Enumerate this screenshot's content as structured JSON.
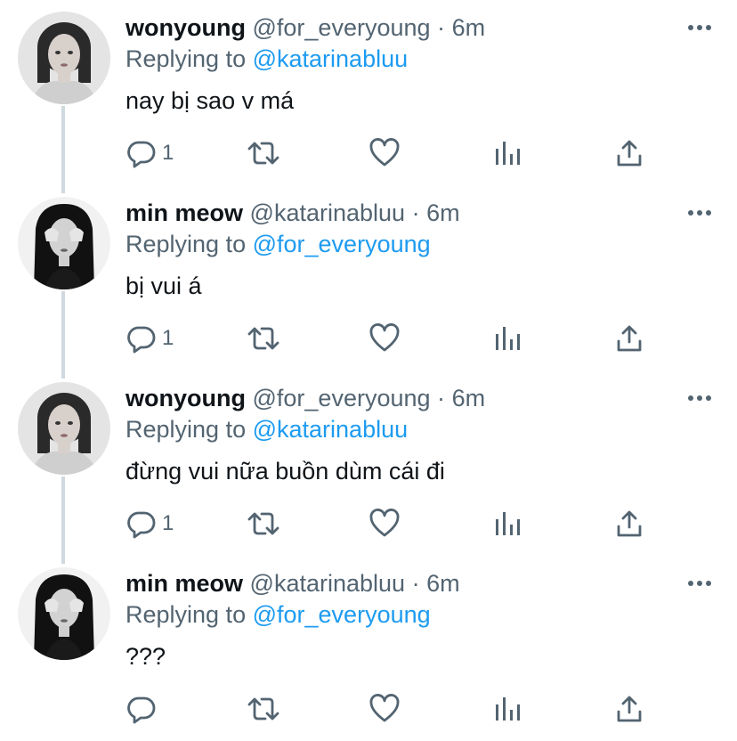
{
  "tweets": [
    {
      "name": "wonyoung",
      "handle": "@for_everyoung",
      "separator": "·",
      "time": "6m",
      "replying_label": "Replying to",
      "replying_to": "@katarinabluu",
      "text": "nay bị sao v má",
      "reply_count": "1",
      "avatar_style": "light"
    },
    {
      "name": "min meow",
      "handle": "@katarinabluu",
      "separator": "·",
      "time": "6m",
      "replying_label": "Replying to",
      "replying_to": "@for_everyoung",
      "text": "bị vui á",
      "reply_count": "1",
      "avatar_style": "dark"
    },
    {
      "name": "wonyoung",
      "handle": "@for_everyoung",
      "separator": "·",
      "time": "6m",
      "replying_label": "Replying to",
      "replying_to": "@katarinabluu",
      "text": "đừng vui nữa buồn dùm cái đi",
      "reply_count": "1",
      "avatar_style": "light"
    },
    {
      "name": "min meow",
      "handle": "@katarinabluu",
      "separator": "·",
      "time": "6m",
      "replying_label": "Replying to",
      "replying_to": "@for_everyoung",
      "text": "???",
      "reply_count": "",
      "avatar_style": "dark"
    }
  ],
  "icons": {
    "reply": "reply-icon",
    "retweet": "retweet-icon",
    "like": "heart-icon",
    "views": "views-icon",
    "share": "share-icon",
    "more": "more-icon"
  },
  "colors": {
    "text": "#0f1419",
    "muted": "#536471",
    "link": "#1d9bf0",
    "thread_line": "#cfd9de"
  }
}
